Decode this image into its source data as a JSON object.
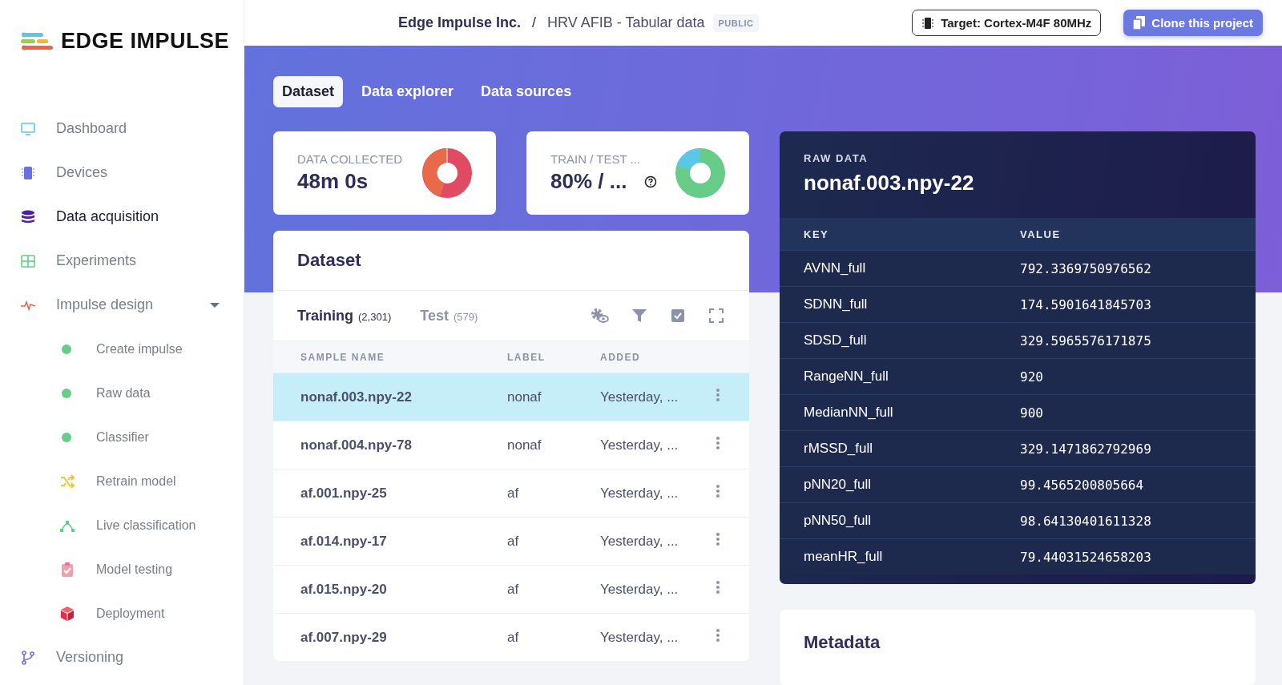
{
  "logo": {
    "text": "EDGE IMPULSE"
  },
  "sidebar": {
    "items": [
      {
        "label": "Dashboard",
        "selected": false
      },
      {
        "label": "Devices",
        "selected": false
      },
      {
        "label": "Data acquisition",
        "selected": true
      },
      {
        "label": "Experiments",
        "selected": false
      },
      {
        "label": "Impulse design",
        "selected": false,
        "expanded": true,
        "children": [
          {
            "label": "Create impulse",
            "kind": "status",
            "color": "#66cc88"
          },
          {
            "label": "Raw data",
            "kind": "status",
            "color": "#66cc88"
          },
          {
            "label": "Classifier",
            "kind": "status",
            "color": "#66cc88"
          },
          {
            "label": "Retrain model",
            "kind": "icon"
          },
          {
            "label": "Live classification",
            "kind": "icon"
          },
          {
            "label": "Model testing",
            "kind": "icon"
          },
          {
            "label": "Deployment",
            "kind": "icon"
          }
        ]
      },
      {
        "label": "Versioning",
        "selected": false
      }
    ]
  },
  "header": {
    "org": "Edge Impulse Inc.",
    "separator": "/",
    "project": "HRV AFIB - Tabular data",
    "badge": "PUBLIC",
    "target_button": "Target: Cortex-M4F 80MHz",
    "clone_button": "Clone this project"
  },
  "tabs": [
    {
      "label": "Dataset",
      "selected": true
    },
    {
      "label": "Data explorer",
      "selected": false
    },
    {
      "label": "Data sources",
      "selected": false
    }
  ],
  "stats": [
    {
      "title": "DATA COLLECTED",
      "value": "48m 0s",
      "help": false
    },
    {
      "title": "TRAIN / TEST ...",
      "value": "80% / ...",
      "help": true
    }
  ],
  "dataset": {
    "title": "Dataset",
    "sample_tabs": [
      {
        "label": "Training",
        "count": "(2,301)",
        "selected": true
      },
      {
        "label": "Test",
        "count": "(579)",
        "selected": false
      }
    ],
    "columns": [
      "SAMPLE NAME",
      "LABEL",
      "ADDED"
    ],
    "rows": [
      {
        "name": "nonaf.003.npy-22",
        "label": "nonaf",
        "added": "Yesterday, ...",
        "selected": true
      },
      {
        "name": "nonaf.004.npy-78",
        "label": "nonaf",
        "added": "Yesterday, ...",
        "selected": false
      },
      {
        "name": "af.001.npy-25",
        "label": "af",
        "added": "Yesterday, ...",
        "selected": false
      },
      {
        "name": "af.014.npy-17",
        "label": "af",
        "added": "Yesterday, ...",
        "selected": false
      },
      {
        "name": "af.015.npy-20",
        "label": "af",
        "added": "Yesterday, ...",
        "selected": false
      },
      {
        "name": "af.007.npy-29",
        "label": "af",
        "added": "Yesterday, ...",
        "selected": false
      }
    ]
  },
  "raw_data": {
    "caption": "RAW DATA",
    "title": "nonaf.003.npy-22",
    "columns": [
      "KEY",
      "VALUE"
    ],
    "rows": [
      {
        "key": "AVNN_full",
        "value": "792.3369750976562"
      },
      {
        "key": "SDNN_full",
        "value": "174.5901641845703"
      },
      {
        "key": "SDSD_full",
        "value": "329.5965576171875"
      },
      {
        "key": "RangeNN_full",
        "value": "920"
      },
      {
        "key": "MedianNN_full",
        "value": "900"
      },
      {
        "key": "rMSSD_full",
        "value": "329.1471862792969"
      },
      {
        "key": "pNN20_full",
        "value": "99.4565200805664"
      },
      {
        "key": "pNN50_full",
        "value": "98.64130401611328"
      },
      {
        "key": "meanHR_full",
        "value": "79.44031524658203"
      }
    ]
  },
  "metadata": {
    "title": "Metadata"
  }
}
